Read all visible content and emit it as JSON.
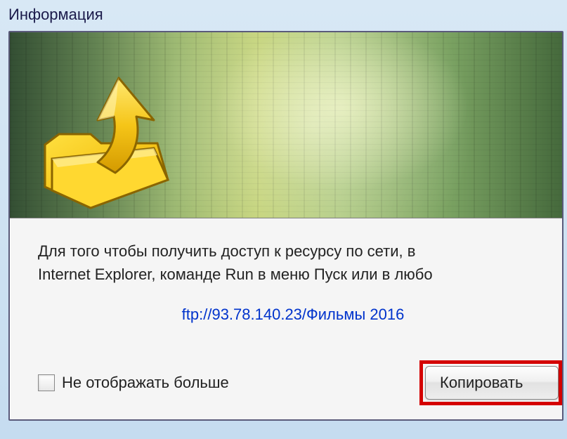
{
  "window": {
    "title": "Информация"
  },
  "message": {
    "line1": "Для того чтобы получить доступ к ресурсу по сети, в",
    "line2": "Internet Explorer, команде Run в меню Пуск или в любо"
  },
  "link": {
    "url": "ftp://93.78.140.23/Фильмы 2016"
  },
  "checkbox": {
    "label": "Не отображать больше",
    "checked": false
  },
  "buttons": {
    "copy": "Копировать"
  }
}
